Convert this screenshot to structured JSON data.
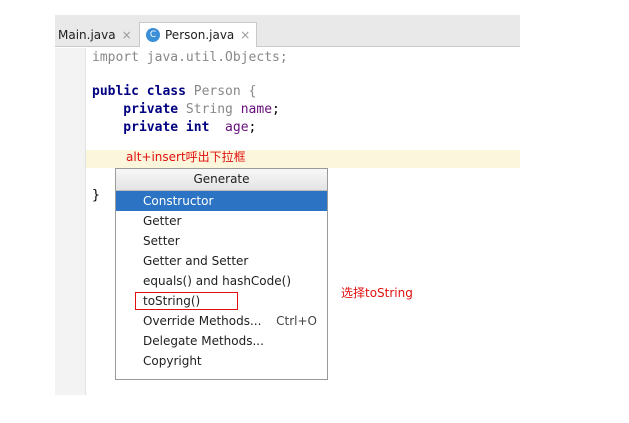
{
  "tabs": [
    {
      "label": "Main.java",
      "close": "×"
    },
    {
      "label": "Person.java",
      "close": "×",
      "icon": "C"
    }
  ],
  "code_lines": {
    "import_kw": "import",
    "import_path": " java.util.Objects;",
    "public_kw": "public class",
    "class_name": " Person {",
    "private1": "    private",
    "type1": " String ",
    "field1": "name",
    "semi1": ";",
    "private2": "    private",
    "type2": " int",
    "field2": "  age",
    "semi2": ";",
    "closing_brace": "}"
  },
  "annotations": {
    "alt_insert": "alt+insert呼出下拉框",
    "select_tostring": "选择toString"
  },
  "popup": {
    "title": "Generate",
    "items": [
      {
        "label": "Constructor",
        "selected": true
      },
      {
        "label": "Getter"
      },
      {
        "label": "Setter"
      },
      {
        "label": "Getter and Setter"
      },
      {
        "label": "equals() and hashCode()"
      },
      {
        "label": "toString()"
      },
      {
        "label": "Override Methods...",
        "shortcut": "Ctrl+O"
      },
      {
        "label": "Delegate Methods..."
      },
      {
        "label": "Copyright"
      }
    ]
  },
  "colors": {
    "selection": "#2c74c3",
    "annotation": "#e01010",
    "keyword": "#000080"
  }
}
